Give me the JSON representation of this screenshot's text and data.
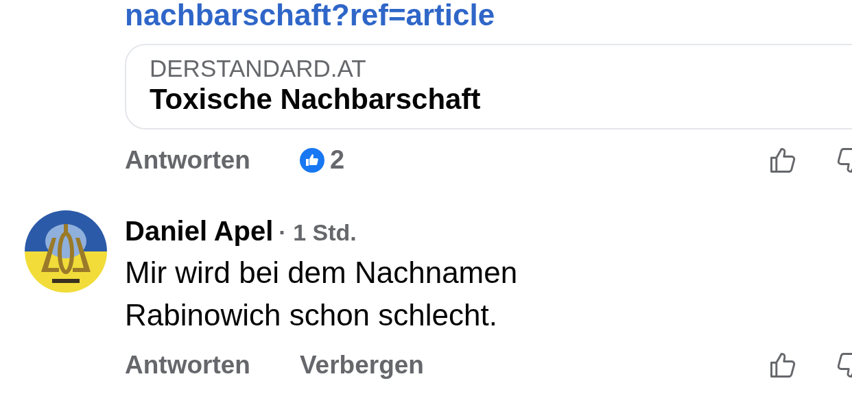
{
  "link": {
    "text": "nachbarschaft?ref=article"
  },
  "link_preview": {
    "domain": "DERSTANDARD.AT",
    "title": "Toxische Nachbarschaft"
  },
  "first_actions": {
    "reply": "Antworten",
    "reaction_count": "2"
  },
  "comment": {
    "author": "Daniel Apel",
    "time": "· 1 Std.",
    "text": "Mir wird bei dem Nachnamen Rabinowich schon schlecht.",
    "actions": [
      "Antworten",
      "Verbergen"
    ]
  }
}
